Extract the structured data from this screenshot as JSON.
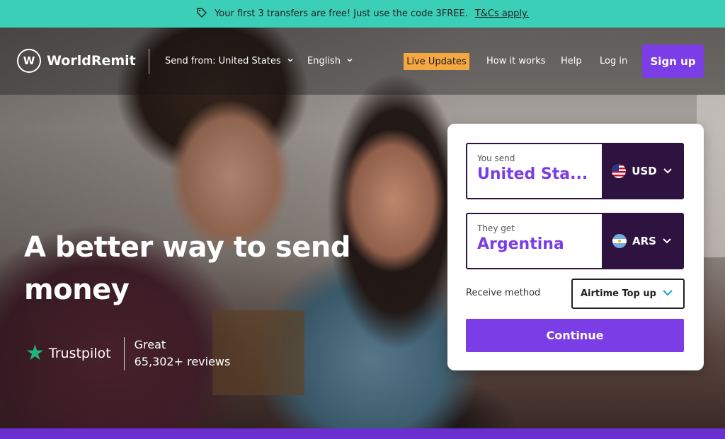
{
  "promo": {
    "text": "Your first 3 transfers are free! Just use the code 3FREE.",
    "link": "T&Cs apply."
  },
  "header": {
    "logo_text": "WorldRemit",
    "logo_badge": "W",
    "send_from": "Send from: United States",
    "language": "English",
    "live_updates": "Live Updates",
    "how_it_works": "How it works",
    "help": "Help",
    "login": "Log in",
    "signup": "Sign up"
  },
  "hero": {
    "headline": "A better way to send money",
    "trustpilot": {
      "name": "Trustpilot",
      "rating_word": "Great",
      "reviews": "65,302+ reviews"
    }
  },
  "calculator": {
    "send": {
      "label": "You send",
      "value": "United Sta...",
      "currency": "USD",
      "flag_icon": "us-flag-icon"
    },
    "get": {
      "label": "They get",
      "value": "Argentina",
      "currency": "ARS",
      "flag_icon": "ar-flag-icon"
    },
    "receive_label": "Receive method",
    "receive_value": "Airtime Top up",
    "continue": "Continue"
  },
  "colors": {
    "promo": "#3ccfb7",
    "brand_purple": "#7a3de6",
    "dark_purple": "#2e1340",
    "live_orange": "#f5a742",
    "trustpilot_green": "#1fb47a"
  }
}
